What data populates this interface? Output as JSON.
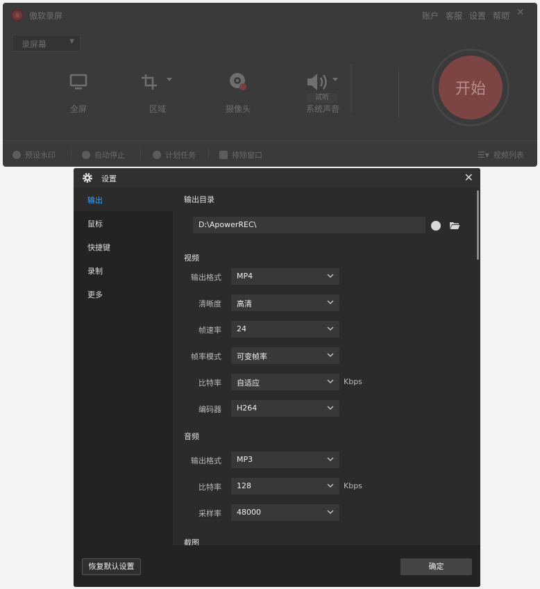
{
  "main_window": {
    "title": "傲软录屏",
    "menu": [
      "账户",
      "客服",
      "设置",
      "帮助"
    ],
    "minimize": "—",
    "close": "✕",
    "mode_select": "录屏幕",
    "record_items": [
      {
        "label": "全屏",
        "icon": "monitor-icon"
      },
      {
        "label": "区域",
        "icon": "crop-icon"
      },
      {
        "label": "摄像头",
        "icon": "webcam-icon"
      },
      {
        "label": "系统声音",
        "icon": "speaker-icon"
      }
    ],
    "trial_badge": "试听",
    "start_button": "开始",
    "bottom_items": [
      "预设水印",
      "自动停止",
      "计划任务",
      "排除窗口"
    ],
    "video_list": "视频列表"
  },
  "settings": {
    "title": "设置",
    "close": "✕",
    "sidebar": [
      {
        "label": "输出",
        "active": true
      },
      {
        "label": "鼠标",
        "active": false
      },
      {
        "label": "快捷键",
        "active": false
      },
      {
        "label": "录制",
        "active": false
      },
      {
        "label": "更多",
        "active": false
      }
    ],
    "output_dir": {
      "heading": "输出目录",
      "path": "D:\\ApowerREC\\"
    },
    "video": {
      "heading": "视频",
      "rows": [
        {
          "label": "输出格式",
          "value": "MP4",
          "unit": ""
        },
        {
          "label": "清晰度",
          "value": "高清",
          "unit": ""
        },
        {
          "label": "帧速率",
          "value": "24",
          "unit": ""
        },
        {
          "label": "帧率模式",
          "value": "可变帧率",
          "unit": ""
        },
        {
          "label": "比特率",
          "value": "自适应",
          "unit": "Kbps"
        },
        {
          "label": "编码器",
          "value": "H264",
          "unit": ""
        }
      ]
    },
    "audio": {
      "heading": "音频",
      "rows": [
        {
          "label": "输出格式",
          "value": "MP3",
          "unit": ""
        },
        {
          "label": "比特率",
          "value": "128",
          "unit": "Kbps"
        },
        {
          "label": "采样率",
          "value": "48000",
          "unit": ""
        }
      ]
    },
    "screenshot_heading": "截图",
    "reset_button": "恢复默认设置",
    "ok_button": "确定",
    "colors": {
      "accent": "#3ea0ff",
      "start_button": "#7d4444"
    }
  }
}
